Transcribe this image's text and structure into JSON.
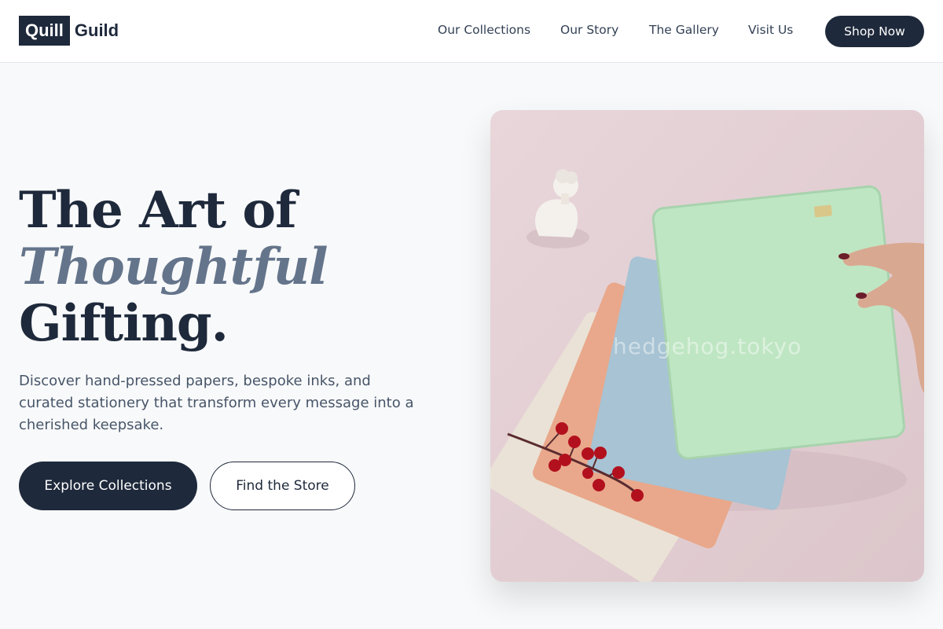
{
  "brand": {
    "logo_box": "Quill",
    "logo_word": "Guild"
  },
  "nav": {
    "links": [
      "Our Collections",
      "Our Story",
      "The Gallery",
      "Visit Us"
    ],
    "cta": "Shop Now"
  },
  "hero": {
    "title_line1": "The Art of",
    "title_line2": "Thoughtful",
    "title_line3": "Gifting.",
    "subtitle": "Discover hand-pressed papers, bespoke inks, and curated stationery that transform every message into a cherished keepsake.",
    "primary_button": "Explore Collections",
    "secondary_button": "Find the Store"
  },
  "image": {
    "subject": "fanned pastel notebooks with statue bust, red berries and hand",
    "watermark": "hedgehog.tokyo"
  },
  "colors": {
    "primary": "#1e293b",
    "accent_text": "#64748b",
    "page_bg": "#f8f9fa",
    "image_bg": "#e3cfd4"
  }
}
